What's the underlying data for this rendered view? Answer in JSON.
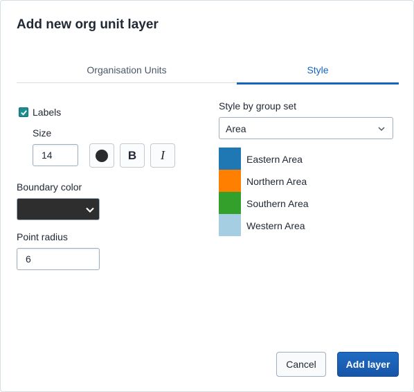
{
  "dialog": {
    "title": "Add new org unit layer",
    "tabs": [
      {
        "label": "Organisation Units"
      },
      {
        "label": "Style"
      }
    ],
    "labels_checkbox": {
      "label": "Labels",
      "checked": true
    },
    "size": {
      "label": "Size",
      "value": "14"
    },
    "font_color_icon": "filled-circle-icon",
    "bold_label": "B",
    "italic_label": "I",
    "boundary_color": {
      "label": "Boundary color",
      "value": "#2e2e2e"
    },
    "point_radius": {
      "label": "Point radius",
      "value": "6"
    },
    "style_by_group_set": {
      "label": "Style by group set",
      "value": "Area"
    },
    "legend": [
      {
        "label": "Eastern Area",
        "color": "#1f78b4"
      },
      {
        "label": "Northern Area",
        "color": "#ff7f00"
      },
      {
        "label": "Southern Area",
        "color": "#33a02c"
      },
      {
        "label": "Western Area",
        "color": "#a6cee3"
      }
    ],
    "cancel_label": "Cancel",
    "add_label": "Add layer"
  }
}
